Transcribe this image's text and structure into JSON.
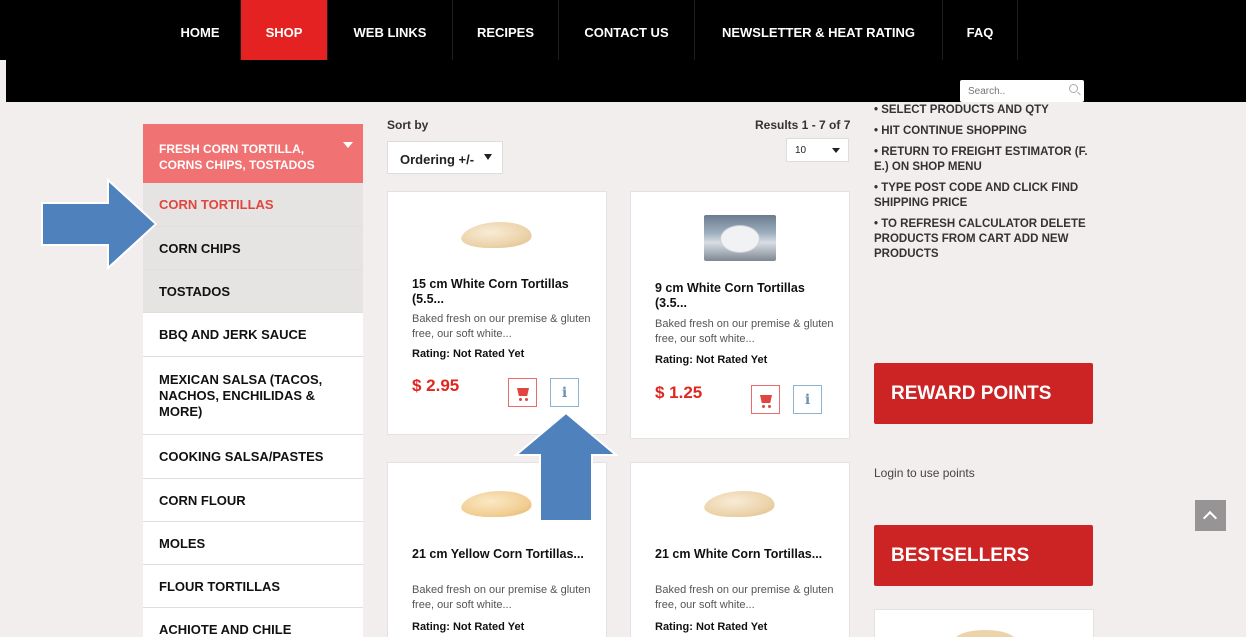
{
  "nav": {
    "items": [
      {
        "label": "HOME",
        "active": false
      },
      {
        "label": "SHOP",
        "active": true
      },
      {
        "label": "WEB LINKS",
        "active": false
      },
      {
        "label": "RECIPES",
        "active": false
      },
      {
        "label": "CONTACT US",
        "active": false
      },
      {
        "label": "NEWSLETTER & HEAT RATING",
        "active": false
      },
      {
        "label": "FAQ",
        "active": false
      }
    ],
    "search_placeholder": "Search.."
  },
  "sidebar": {
    "header": "FRESH CORN TORTILLA, CORNS CHIPS, TOSTADOS",
    "items": [
      {
        "label": "CORN TORTILLAS",
        "selected": true
      },
      {
        "label": "CORN CHIPS"
      },
      {
        "label": "TOSTADOS"
      },
      {
        "label": "BBQ AND JERK SAUCE"
      },
      {
        "label": "MEXICAN SALSA (TACOS, NACHOS, ENCHILIDAS & MORE)"
      },
      {
        "label": "COOKING SALSA/PASTES"
      },
      {
        "label": "CORN FLOUR"
      },
      {
        "label": "MOLES"
      },
      {
        "label": "FLOUR TORTILLAS"
      },
      {
        "label": "ACHIOTE AND CHILE"
      }
    ]
  },
  "listing": {
    "sort_label": "Sort by",
    "sort_value": "Ordering +/-",
    "results_label": "Results 1 - 7 of 7",
    "limit_value": "10"
  },
  "products": [
    {
      "title": "15 cm White Corn Tortillas (5.5...",
      "desc": "Baked fresh on our premise & gluten free, our soft white...",
      "rating": "Rating: Not Rated Yet",
      "price": "$ 2.95"
    },
    {
      "title": "9 cm White Corn Tortillas (3.5...",
      "desc": "Baked fresh on our premise & gluten free, our soft white...",
      "rating": "Rating: Not Rated Yet",
      "price": "$ 1.25"
    },
    {
      "title": "21 cm Yellow Corn Tortillas...",
      "desc": "Baked fresh on our premise & gluten free, our soft white...",
      "rating": "Rating: Not Rated Yet"
    },
    {
      "title": "21 cm White Corn Tortillas...",
      "desc": "Baked fresh on our premise & gluten free, our soft white...",
      "rating": "Rating: Not Rated Yet"
    }
  ],
  "right": {
    "rules": [
      "• SELECT PRODUCTS AND QTY",
      "• HIT CONTINUE SHOPPING",
      "• RETURN TO FREIGHT ESTIMATOR (F. E.) ON SHOP MENU",
      "• TYPE POST CODE AND CLICK FIND SHIPPING PRICE",
      "• TO REFRESH CALCULATOR DELETE PRODUCTS FROM CART ADD NEW PRODUCTS"
    ],
    "reward_title": "REWARD POINTS",
    "login_text": "Login to use points",
    "bestsellers_title": "BESTSELLERS"
  },
  "colors": {
    "accent_red": "#e52222",
    "sidebar_header": "#f07272",
    "box_red": "#cc2424",
    "annotation_arrow": "#4f81bd"
  },
  "icons": [
    "search-icon",
    "cart-icon",
    "info-icon",
    "scroll-top-icon",
    "chevron-down-icon"
  ]
}
